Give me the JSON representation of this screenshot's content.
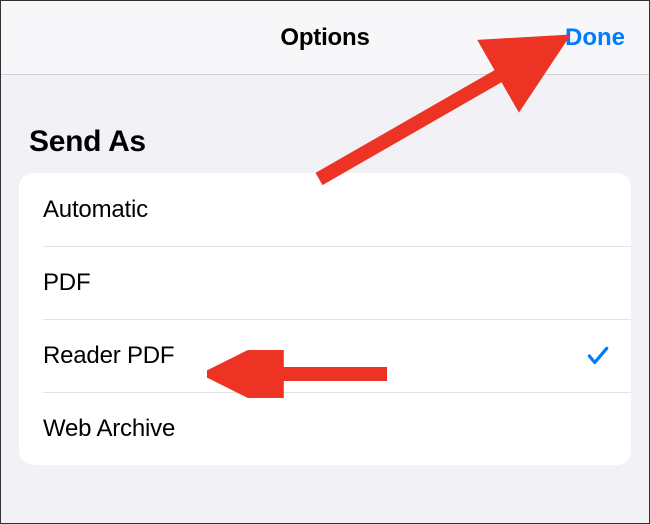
{
  "header": {
    "title": "Options",
    "done_label": "Done"
  },
  "section_header": "Send As",
  "options": [
    {
      "label": "Automatic",
      "selected": false
    },
    {
      "label": "PDF",
      "selected": false
    },
    {
      "label": "Reader PDF",
      "selected": true
    },
    {
      "label": "Web Archive",
      "selected": false
    }
  ]
}
